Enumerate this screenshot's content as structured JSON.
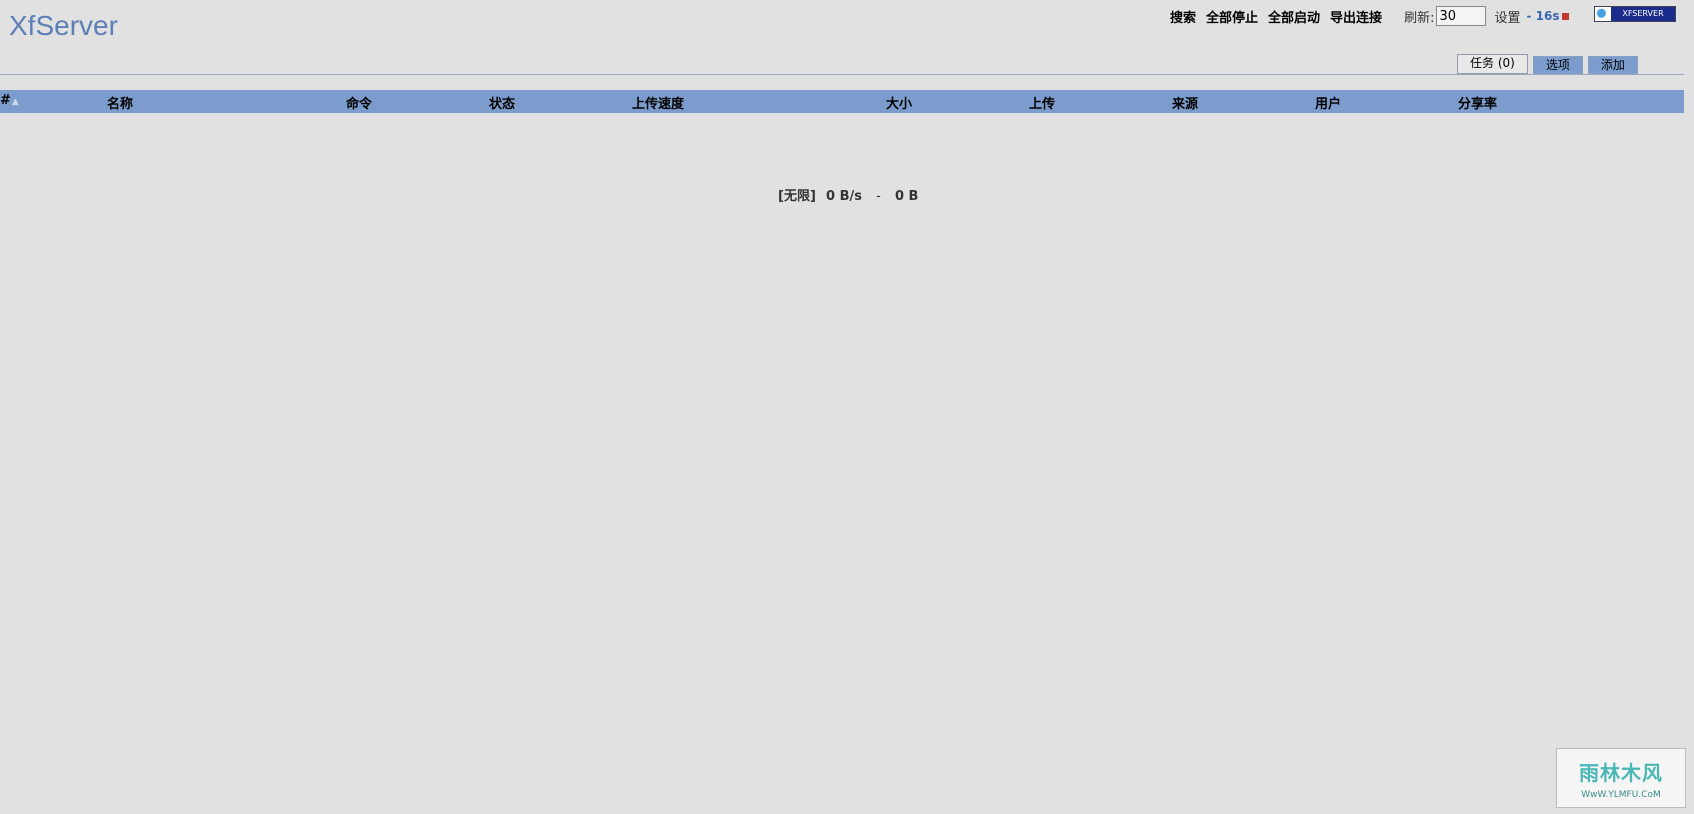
{
  "app": {
    "title": "XfServer"
  },
  "toolbar": {
    "actions": [
      "搜索",
      "全部停止",
      "全部启动",
      "导出连接"
    ],
    "refresh_label": "刷新:",
    "refresh_value": "30",
    "settings_label": "设置",
    "countdown": "- 16s",
    "logo_text": "XFSERVER"
  },
  "tabs": [
    {
      "label": "任务 (0)",
      "active": true
    },
    {
      "label": "选项",
      "active": false
    },
    {
      "label": "添加",
      "active": false
    }
  ],
  "table": {
    "columns": [
      "#",
      "名称",
      "命令",
      "状态",
      "上传速度",
      "大小",
      "上传",
      "来源",
      "用户",
      "分享率"
    ],
    "sort_indicator": "▲",
    "rows": []
  },
  "footer": {
    "limit": "[无限]",
    "speed": "0 B/s",
    "separator": "-",
    "total": "0 B"
  },
  "watermark": {
    "main": "雨林木风",
    "url": "WwW.YLMFU.CoM"
  },
  "colors": {
    "background": "#e1e1e1",
    "header_row": "#7c9ccd",
    "title": "#5c7fb5",
    "countdown": "#3a66b0"
  }
}
